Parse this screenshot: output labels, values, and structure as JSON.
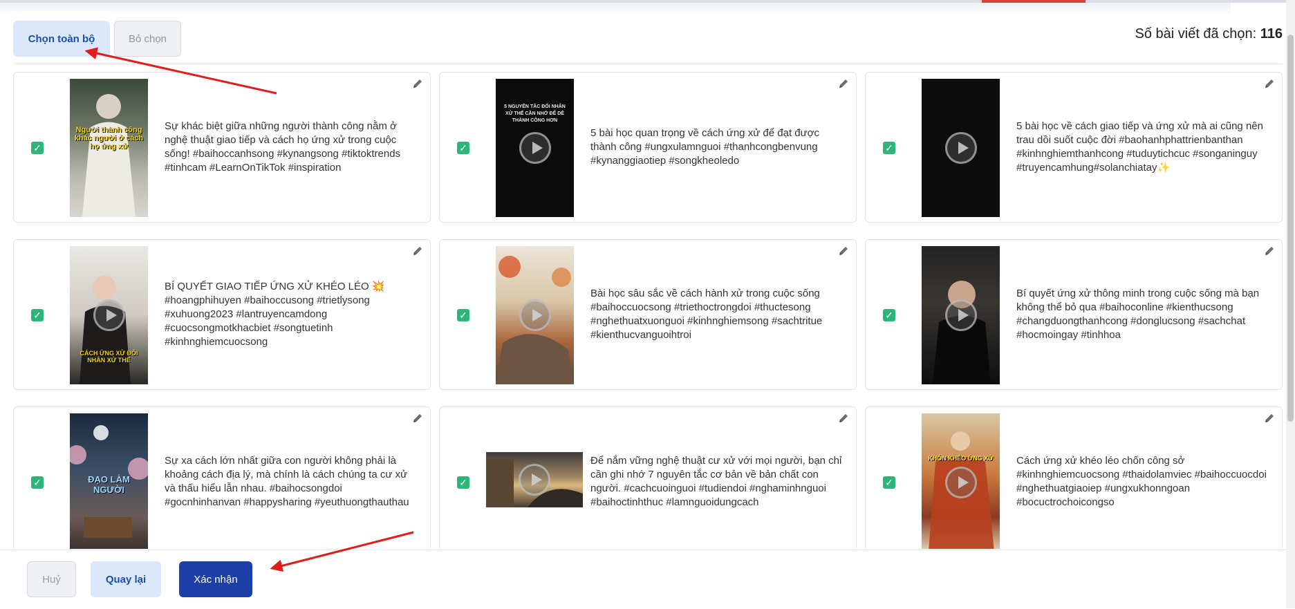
{
  "toolbar": {
    "select_all_label": "Chọn toàn bộ",
    "deselect_label": "Bỏ chọn",
    "selected_count_label": "Số bài viết đã chọn:",
    "selected_count": "116"
  },
  "posts": [
    {
      "checked": true,
      "text": "Sự khác biệt giữa những người thành công nằm ở nghệ thuật giao tiếp và cách họ ứng xử trong cuộc sống! #baihoccanhsong #kynangsong #tiktoktrends #tinhcam #LearnOnTikTok #inspiration",
      "thumb_caption": "Người thành công khác người ở cách họ ứng xử"
    },
    {
      "checked": true,
      "text": "5 bài học quan trọng về cách ứng xử để đạt được thành công #ungxulamnguoi #thanhcongbenvung #kynanggiaotiep #songkheoledo",
      "thumb_caption": "5 NGUYÊN TẮC ĐỐI NHÂN XỬ THẾ CẦN NHỚ ĐỂ DỄ THÀNH CÔNG HƠN"
    },
    {
      "checked": true,
      "text": "5 bài học về cách giao tiếp và ứng xử mà ai cũng nên trau dồi suốt cuộc đời #baohanhphattrienbanthan #kinhnghiemthanhcong #tuduytichcuc #songaninguy #truyencamhung#solanchiatay✨",
      "thumb_caption": ""
    },
    {
      "checked": true,
      "text": "BÍ QUYẾT GIAO TIẾP ỨNG XỬ KHÉO LÉO 💥 #hoangphihuyen #baihoccusong #trietlysong #xuhuong2023 #lantruyencamdong #cuocsongmotkhacbiet #songtuetinh #kinhnghiemcuocsong",
      "thumb_caption": "CÁCH ỨNG XỬ ĐỐI NHÂN XỬ THẾ"
    },
    {
      "checked": true,
      "text": "Bài học sâu sắc về cách hành xử trong cuộc sống #baihoccuocsong #triethoctrongdoi #thuctesong #nghethuatxuonguoi #kinhnghiemsong #sachtritue #kienthucvanguoihtroi",
      "thumb_caption": ""
    },
    {
      "checked": true,
      "text": "Bí quyết ứng xử thông minh trong cuộc sống mà bạn không thể bỏ qua #baihoconline #kienthucsong #changduongthanhcong #donglucsong #sachchat #hocmoingay #tinhhoa",
      "thumb_caption": ""
    },
    {
      "checked": true,
      "text": "Sự xa cách lớn nhất giữa con người không phải là khoảng cách địa lý, mà chính là cách chúng ta cư xử và thấu hiểu lẫn nhau. #baihocsongdoi #gocnhinhanvan #happysharing #yeuthuongthauthau",
      "thumb_caption": "ĐẠO LÀM NGƯỜI"
    },
    {
      "checked": true,
      "text": "Để nắm vững nghệ thuật cư xử với mọi người, bạn chỉ cần ghi nhớ 7 nguyên tắc cơ bản về bản chất con người. #cachcuoinguoi #tudiendoi #nghaminhnguoi #baihoctinhthuc #lamnguoidungcach",
      "thumb_caption": ""
    },
    {
      "checked": true,
      "text": "Cách ứng xử khéo léo chốn công sở #kinhnghiemcuocsong #thaidolamviec #baihoccuocdoi #nghethuatgiaoiep #ungxukhonngoan #bocuctrochoicongso",
      "thumb_caption": "KHÔN KHÉO ỨNG XỬ"
    }
  ],
  "footer": {
    "cancel_label": "Huỷ",
    "back_label": "Quay lại",
    "confirm_label": "Xác nhận"
  },
  "colors": {
    "accent": "#1d3fa8",
    "accent_light": "#dbe8fb",
    "check": "#2fb47a",
    "arrow": "#e31b1b"
  }
}
